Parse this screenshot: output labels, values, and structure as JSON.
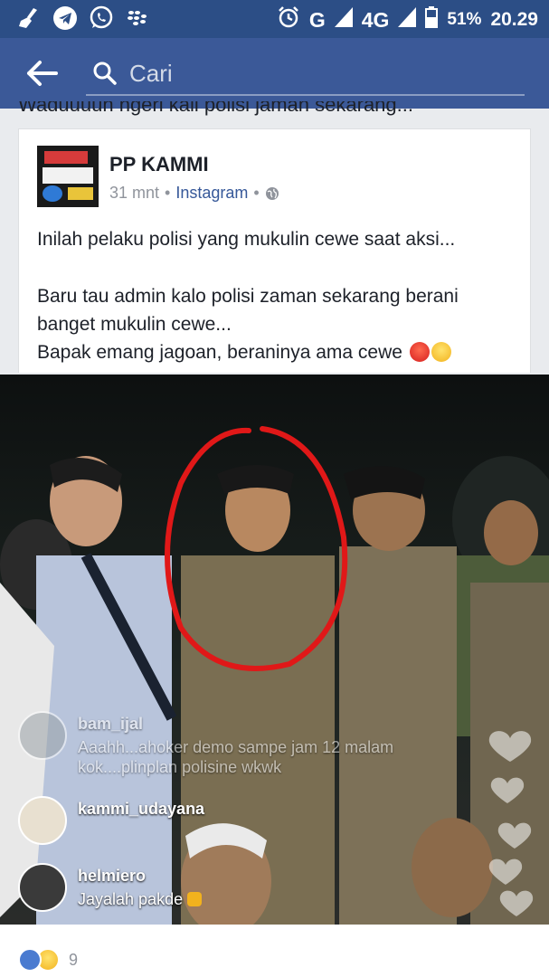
{
  "status_bar": {
    "network": "G",
    "network2": "4G",
    "network2_sup": "4G",
    "battery": "51%",
    "time": "20.29",
    "icons": [
      "broom-icon",
      "telegram-icon",
      "whatsapp-icon",
      "blackberry-icon",
      "alarm-icon",
      "signal-icon",
      "battery-icon"
    ]
  },
  "search": {
    "placeholder": "Cari"
  },
  "prev_post_line": "Waduuuuh ngeri kali polisi jaman sekarang...",
  "post": {
    "page_name": "PP KAMMI",
    "time": "31 mnt",
    "source": "Instagram",
    "separator": "•",
    "paragraph1": "Inilah pelaku polisi yang mukulin cewe saat aksi...",
    "paragraph2_line1": "Baru tau admin kalo polisi zaman sekarang berani",
    "paragraph2_line2": "banget mukulin cewe...",
    "paragraph3": "Bapak emang jagoan, beraninya ama cewe"
  },
  "live_comments": [
    {
      "name": "bam_ijal",
      "text1": "Aaahh...ahoker demo sampe jam 12 malam",
      "text2": "kok....plinplan polisine wkwk"
    },
    {
      "name": "kammi_udayana",
      "text1": ""
    },
    {
      "name": "helmiero",
      "text1": "Jayalah pakde"
    }
  ],
  "reactions": {
    "count": "9"
  },
  "colors": {
    "statusbar": "#2c4e86",
    "header": "#3b5998",
    "like": "#4a7bd0",
    "circle_annotation": "#e01818"
  }
}
